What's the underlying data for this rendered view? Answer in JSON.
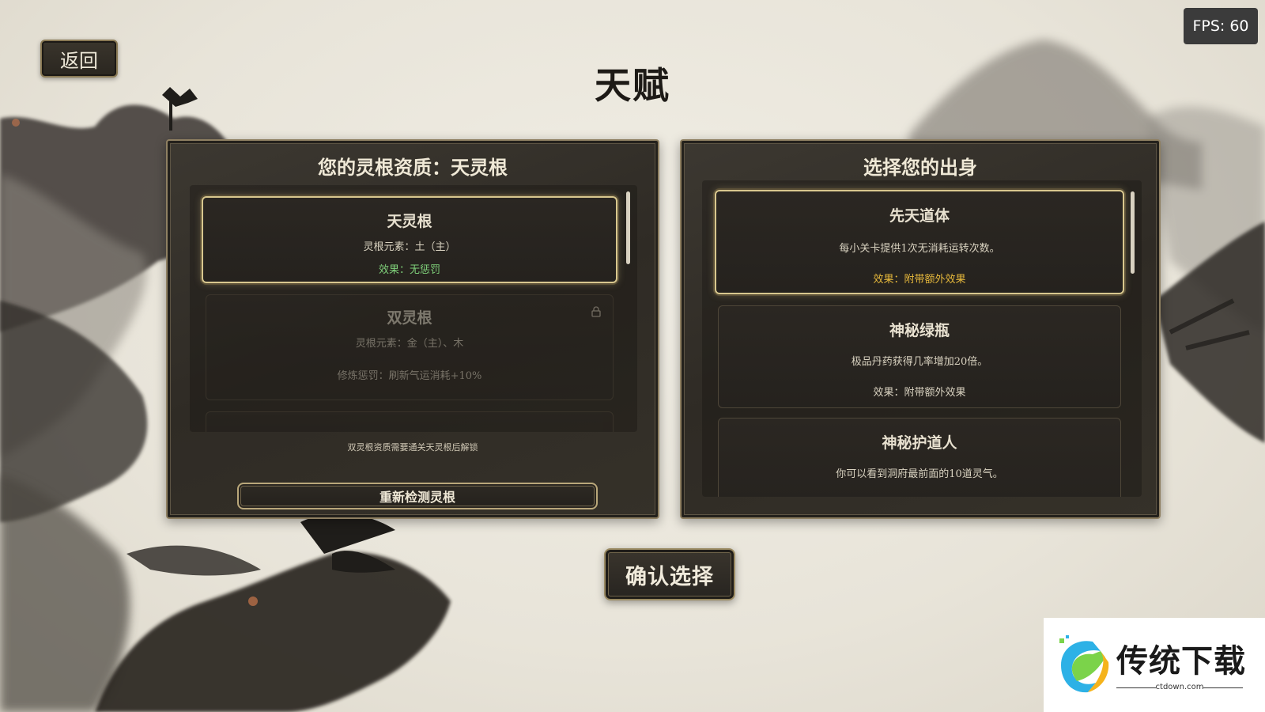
{
  "header": {
    "back_label": "返回",
    "title": "天赋",
    "fps": "FPS: 60"
  },
  "left_panel": {
    "title": "您的灵根资质：天灵根",
    "items": [
      {
        "name": "天灵根",
        "elements": "灵根元素：土（主）",
        "effect": "效果：无惩罚",
        "state": "selected"
      },
      {
        "name": "双灵根",
        "elements": "灵根元素：金（主）、木",
        "effect": "修炼惩罚：刷新气运消耗+10%",
        "state": "locked"
      }
    ],
    "hint": "双灵根资质需要通关天灵根后解锁",
    "recheck_label": "重新检测灵根"
  },
  "right_panel": {
    "title": "选择您的出身",
    "items": [
      {
        "name": "先天道体",
        "desc": "每小关卡提供1次无消耗运转次数。",
        "effect": "效果：附带额外效果",
        "state": "selected"
      },
      {
        "name": "神秘绿瓶",
        "desc": "极品丹药获得几率增加20倍。",
        "effect": "效果：附带额外效果",
        "state": "normal"
      },
      {
        "name": "神秘护道人",
        "desc": "你可以看到洞府最前面的10道灵气。",
        "effect": "",
        "state": "normal"
      }
    ]
  },
  "confirm_label": "确认选择",
  "watermark": {
    "text": "传统下载",
    "url": "ctdown.com"
  },
  "colors": {
    "effect_green": "#7fd07a",
    "effect_gold": "#e7b93c",
    "panel_bg": "#332f29",
    "selected_border": "#d8c78e"
  }
}
